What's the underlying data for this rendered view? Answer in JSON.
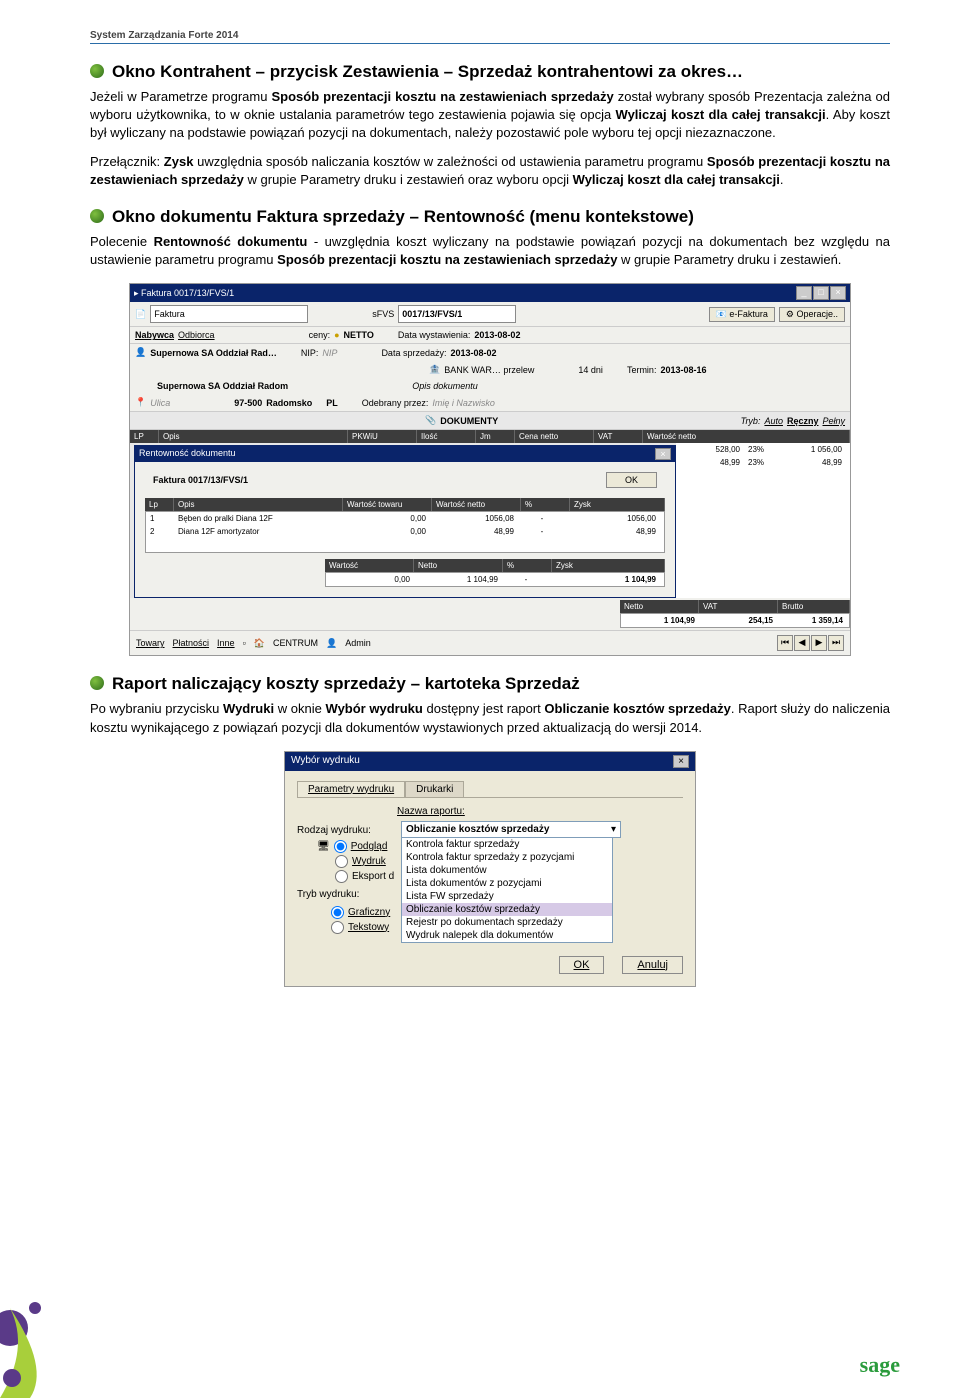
{
  "header": "System Zarządzania Forte 2014",
  "s1": {
    "title": "Okno Kontrahent – przycisk Zestawienia – Sprzedaż kontrahentowi za okres…",
    "p1a": "Jeżeli w Parametrze programu ",
    "p1b": "Sposób prezentacji kosztu na zestawieniach sprzedaży",
    "p1c": " został wybrany sposób Prezentacja zależna od wyboru użytkownika, to w oknie ustalania parametrów tego zestawienia pojawia się opcja ",
    "p1d": "Wyliczaj koszt dla całej transakcji",
    "p1e": ". Aby koszt był wyliczany na podstawie powiązań pozycji na dokumentach, należy pozostawić pole wyboru tej opcji niezaznaczone.",
    "p2a": "Przełącznik: ",
    "p2b": "Zysk",
    "p2c": " uwzględnia sposób naliczania kosztów w zależności od ustawienia parametru programu ",
    "p2d": "Sposób prezentacji kosztu na zestawieniach sprzedaży",
    "p2e": " w grupie Parametry druku i zestawień oraz wyboru opcji ",
    "p2f": "Wyliczaj koszt dla całej transakcji",
    "p2g": "."
  },
  "s2": {
    "title": "Okno dokumentu Faktura sprzedaży – Rentowność (menu kontekstowe)",
    "p1a": "Polecenie ",
    "p1b": "Rentowność dokumentu",
    "p1c": " - uwzględnia koszt wyliczany na podstawie powiązań pozycji na dokumentach bez względu na ustawienie parametru programu ",
    "p1d": "Sposób prezentacji kosztu na zestawieniach sprzedaży",
    "p1e": " w grupie Parametry druku i zestawień."
  },
  "sc1": {
    "wintitle": "Faktura 0017/13/FVS/1",
    "doctype": "Faktura",
    "series": "sFVS",
    "docnum": "0017/13/FVS/1",
    "efaktura": "e-Faktura",
    "operacje": "Operacje..",
    "nabywca": "Nabywca",
    "odbiorca": "Odbiorca",
    "ceny": "ceny:",
    "netto": "NETTO",
    "dwyst": "Data wystawienia:",
    "dwyst_v": "2013-08-02",
    "dsprz": "Data sprzedaży:",
    "dsprz_v": "2013-08-02",
    "nab_name": "Supernowa SA Oddział Rad…",
    "nip_l": "NIP:",
    "nip_v": "NIP",
    "bank": "BANK WAR… przelew",
    "dni": "14 dni",
    "termin_l": "Termin:",
    "termin_v": "2013-08-16",
    "nab_full": "Supernowa SA Oddział Radom",
    "opis_dok": "Opis dokumentu",
    "ulica": "Ulica",
    "kod": "97-500",
    "miasto": "Radomsko",
    "kraj": "PL",
    "odebrany": "Odebrany przez:",
    "odebrany_v": "Imię i Nazwisko",
    "dokumenty": "DOKUMENTY",
    "tryb": "Tryb:",
    "auto": "Auto",
    "reczny": "Ręczny",
    "pelny": "Pełny",
    "hdr_lp": "LP",
    "hdr_opis": "Opis",
    "hdr_pkwiu": "PKWiU",
    "hdr_ilosc": "Ilość",
    "hdr_jm": "Jm",
    "hdr_cennetto": "Cena netto",
    "hdr_vat": "VAT",
    "hdr_wartnetto": "Wartość netto",
    "r1_cn": "528,00",
    "r1_vat": "23%",
    "r1_wn": "1 056,00",
    "r2_cn": "48,99",
    "r2_vat": "23%",
    "r2_wn": "48,99",
    "modal_title": "Rentowność dokumentu",
    "modal_doc": "Faktura 0017/13/FVS/1",
    "ok": "OK",
    "m_lp": "Lp",
    "m_opis": "Opis",
    "m_wt": "Wartość towaru",
    "m_wn": "Wartość netto",
    "m_pc": "%",
    "m_zysk": "Zysk",
    "mr1_lp": "1",
    "mr1_op": "Bęben do pralki Diana 12F",
    "mr1_wt": "0,00",
    "mr1_wn": "1056,08",
    "mr1_pc": "-",
    "mr1_z": "1056,00",
    "mr2_lp": "2",
    "mr2_op": "Diana 12F amortyzator",
    "mr2_wt": "0,00",
    "mr2_wn": "48,99",
    "mr2_pc": "-",
    "mr2_z": "48,99",
    "tot_l1": "Wartość",
    "tot_l2": "Netto",
    "tot_l3": "%",
    "tot_l4": "Zysk",
    "tot_v1": "0,00",
    "tot_v2": "1 104,99",
    "tot_v3": "-",
    "tot_v4": "1 104,99",
    "sum_l1": "Netto",
    "sum_l2": "VAT",
    "sum_l3": "Brutto",
    "sum_v1": "1 104,99",
    "sum_v2": "254,15",
    "sum_v3": "1 359,14",
    "towary": "Towary",
    "platnosci": "Płatności",
    "inne": "Inne",
    "centrum": "CENTRUM",
    "admin": "Admin"
  },
  "s3": {
    "title": "Raport naliczający koszty sprzedaży – kartoteka Sprzedaż",
    "p1a": "Po wybraniu przycisku ",
    "p1b": "Wydruki",
    "p1c": " w oknie ",
    "p1d": "Wybór wydruku",
    "p1e": " dostępny jest raport ",
    "p1f": "Obliczanie kosztów sprzedaży",
    "p1g": ". Raport służy do naliczenia kosztu wynikającego z powiązań pozycji dla dokumentów wystawionych przed aktualizacją do wersji 2014."
  },
  "sc2": {
    "title": "Wybór wydruku",
    "tab1": "Parametry wydruku",
    "tab2": "Drukarki",
    "nazwa": "Nazwa raportu:",
    "sel": "Obliczanie kosztów sprzedaży",
    "rodzaj": "Rodzaj wydruku:",
    "r1": "Podgląd",
    "r2": "Wydruk",
    "r3": "Eksport d",
    "tryb": "Tryb wydruku:",
    "t1": "Graficzny",
    "t2": "Tekstowy",
    "opts": [
      "Kontrola faktur sprzedaży",
      "Kontrola faktur sprzedaży z pozycjami",
      "Lista dokumentów",
      "Lista dokumentów z pozycjami",
      "Lista FW sprzedaży",
      "Obliczanie kosztów sprzedaży",
      "Rejestr po dokumentach sprzedaży",
      "Wydruk nalepek dla dokumentów"
    ],
    "ok": "OK",
    "anuluj": "Anuluj"
  },
  "logo": "sage"
}
